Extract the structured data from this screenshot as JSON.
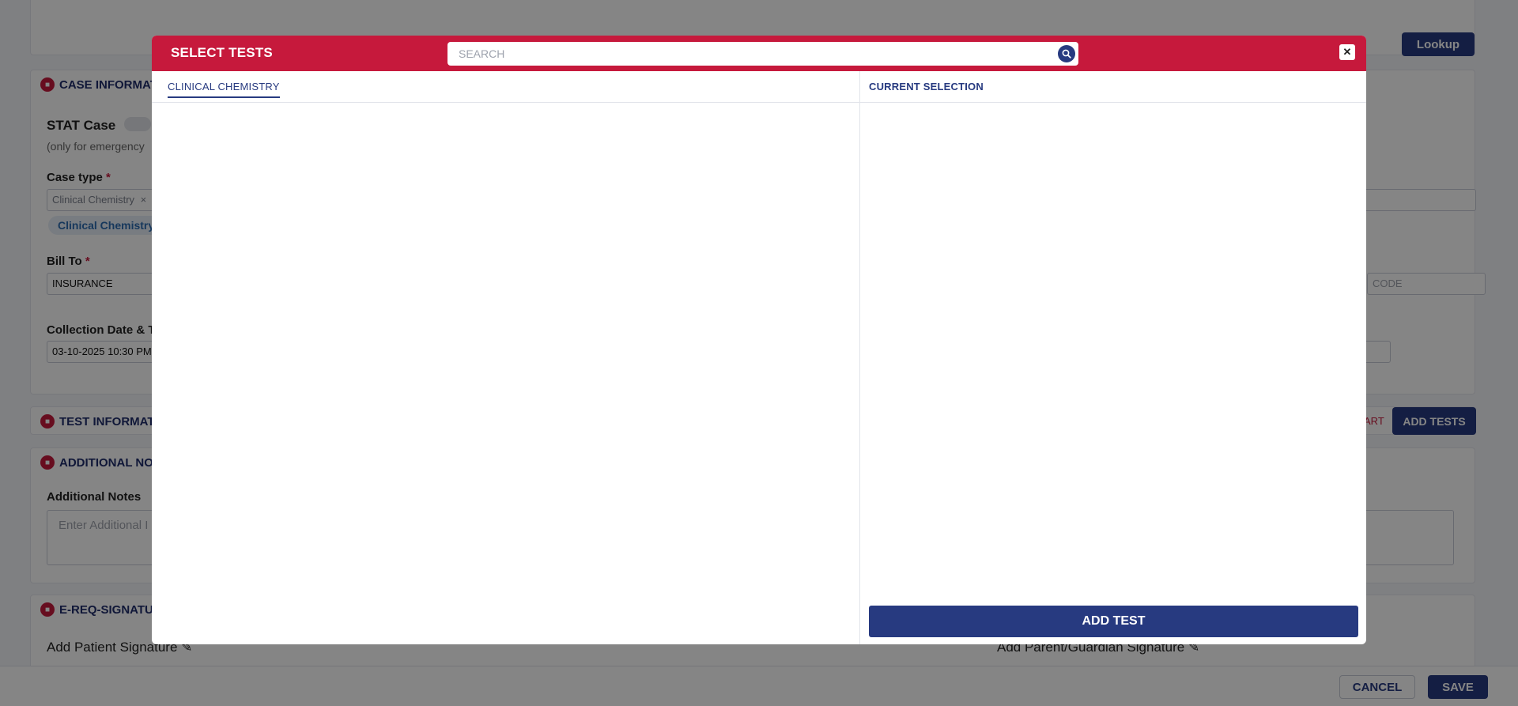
{
  "background": {
    "lookup_button": "Lookup",
    "case_section": {
      "title": "CASE INFORMATI",
      "stat_label": "STAT Case",
      "stat_note": "(only for emergency",
      "case_type_label": "Case type",
      "case_type_chip": "Clinical Chemistry",
      "case_type_tag": "Clinical Chemistry",
      "bill_to_label": "Bill To",
      "bill_to_value": "INSURANCE",
      "code_placeholder": "CODE",
      "collection_label": "Collection Date & T",
      "collection_value": "03-10-2025 10:30 PM"
    },
    "test_section": {
      "title": "TEST INFORMATIO",
      "art_text": "ART",
      "add_tests_button": "ADD TESTS"
    },
    "notes_section": {
      "title": "ADDITIONAL NOT",
      "label": "Additional Notes",
      "placeholder": "Enter Additional I"
    },
    "signature_section": {
      "title": "E-REQ-SIGNATU",
      "patient_sig": "Add Patient Signature",
      "guardian_sig": "Add Parent/Guardian Signature"
    },
    "footer": {
      "cancel": "CANCEL",
      "save": "SAVE"
    }
  },
  "modal": {
    "title": "SELECT TESTS",
    "search_placeholder": "SEARCH",
    "search_icon": "search-icon",
    "close_icon": "close-icon",
    "tabs": [
      {
        "label": "CLINICAL CHEMISTRY",
        "active": true
      }
    ],
    "current_selection_title": "CURRENT SELECTION",
    "add_test_button": "ADD TEST"
  },
  "colors": {
    "header_red": "#c6193c",
    "navy": "#273a80"
  }
}
